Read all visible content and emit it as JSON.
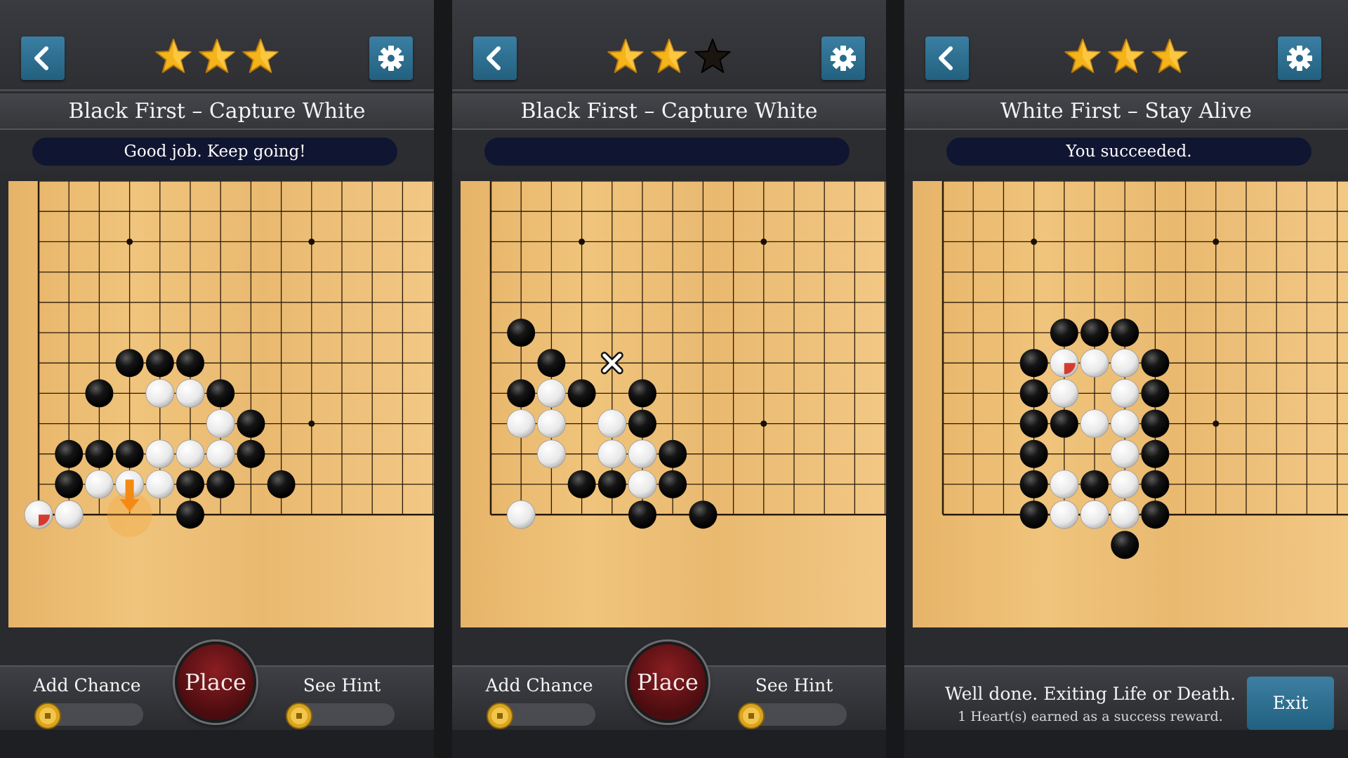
{
  "panels": [
    {
      "title": "Black First – Capture White",
      "message": "Good job. Keep going!",
      "stars": [
        "gold",
        "gold",
        "gold"
      ],
      "add_chance_label": "Add Chance",
      "place_label": "Place",
      "see_hint_label": "See Hint",
      "stones": {
        "black": [
          [
            3,
            6
          ],
          [
            4,
            6
          ],
          [
            5,
            6
          ],
          [
            2,
            7
          ],
          [
            6,
            7
          ],
          [
            7,
            8
          ],
          [
            1,
            9
          ],
          [
            2,
            9
          ],
          [
            3,
            9
          ],
          [
            7,
            9
          ],
          [
            1,
            10
          ],
          [
            5,
            10
          ],
          [
            6,
            10
          ],
          [
            8,
            10
          ],
          [
            5,
            11
          ]
        ],
        "white": [
          [
            4,
            7
          ],
          [
            5,
            7
          ],
          [
            6,
            8
          ],
          [
            4,
            9
          ],
          [
            5,
            9
          ],
          [
            6,
            9
          ],
          [
            2,
            10
          ],
          [
            3,
            10
          ],
          [
            4,
            10
          ],
          [
            0,
            11
          ],
          [
            1,
            11
          ]
        ],
        "last_move": [
          0,
          11
        ],
        "hint_arrow": [
          3,
          11
        ]
      }
    },
    {
      "title": "Black First – Capture White",
      "message": "",
      "stars": [
        "gold",
        "gold",
        "dark"
      ],
      "add_chance_label": "Add Chance",
      "place_label": "Place",
      "see_hint_label": "See Hint",
      "stones": {
        "black": [
          [
            1,
            5
          ],
          [
            2,
            6
          ],
          [
            1,
            7
          ],
          [
            3,
            7
          ],
          [
            5,
            7
          ],
          [
            5,
            8
          ],
          [
            6,
            9
          ],
          [
            3,
            10
          ],
          [
            4,
            10
          ],
          [
            6,
            10
          ],
          [
            5,
            11
          ],
          [
            7,
            11
          ]
        ],
        "white": [
          [
            2,
            7
          ],
          [
            1,
            8
          ],
          [
            2,
            8
          ],
          [
            4,
            8
          ],
          [
            2,
            9
          ],
          [
            4,
            9
          ],
          [
            5,
            9
          ],
          [
            5,
            10
          ],
          [
            1,
            11
          ]
        ],
        "last_move": null,
        "x_mark": [
          4,
          6
        ]
      }
    },
    {
      "title": "White First – Stay Alive",
      "message": "You succeeded.",
      "stars": [
        "gold",
        "gold",
        "gold"
      ],
      "exit_message": "Well done. Exiting Life or Death.",
      "exit_sub": "1 Heart(s) earned as a success reward.",
      "exit_label": "Exit",
      "stones": {
        "black": [
          [
            4,
            5
          ],
          [
            5,
            5
          ],
          [
            6,
            5
          ],
          [
            3,
            6
          ],
          [
            7,
            6
          ],
          [
            3,
            7
          ],
          [
            7,
            7
          ],
          [
            3,
            8
          ],
          [
            4,
            8
          ],
          [
            7,
            8
          ],
          [
            3,
            9
          ],
          [
            7,
            9
          ],
          [
            3,
            10
          ],
          [
            5,
            10
          ],
          [
            7,
            10
          ],
          [
            3,
            11
          ],
          [
            7,
            11
          ],
          [
            6,
            12
          ]
        ],
        "white": [
          [
            4,
            6
          ],
          [
            5,
            6
          ],
          [
            6,
            6
          ],
          [
            4,
            7
          ],
          [
            6,
            7
          ],
          [
            5,
            8
          ],
          [
            6,
            8
          ],
          [
            6,
            9
          ],
          [
            4,
            10
          ],
          [
            6,
            10
          ],
          [
            4,
            11
          ],
          [
            5,
            11
          ],
          [
            6,
            11
          ]
        ],
        "last_move": [
          4,
          6
        ]
      }
    }
  ],
  "colors": {
    "accent_blue": "#2f6f92",
    "place_red": "#7a161a",
    "star_gold": "#f4b41a",
    "last_move_marker": "#d63a2f"
  },
  "icons": [
    "back-chevron-icon",
    "gear-icon",
    "star-icon",
    "coin-icon"
  ]
}
